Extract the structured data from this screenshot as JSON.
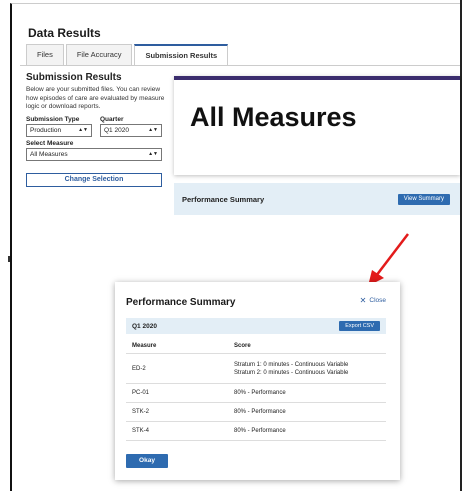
{
  "page": {
    "title": "Data Results"
  },
  "tabs": [
    {
      "label": "Files"
    },
    {
      "label": "File Accuracy"
    },
    {
      "label": "Submission Results"
    }
  ],
  "submission": {
    "title": "Submission Results",
    "description": "Below are your submitted files. You can review how episodes of care are evaluated by measure logic or download reports.",
    "type_label": "Submission Type",
    "type_value": "Production",
    "quarter_label": "Quarter",
    "quarter_value": "Q1 2020",
    "measure_label": "Select Measure",
    "measure_value": "All Measures",
    "change_button": "Change Selection"
  },
  "main": {
    "heading": "All Measures",
    "summary_label": "Performance Summary",
    "view_summary_button": "View Summary"
  },
  "modal": {
    "title": "Performance Summary",
    "close_label": "Close",
    "quarter": "Q1 2020",
    "export_button": "Export CSV",
    "columns": [
      "Measure",
      "Score"
    ],
    "rows": [
      {
        "measure": "ED-2",
        "score_lines": [
          "Stratum 1: 0 minutes - Continuous Variable",
          "Stratum 2: 0 minutes - Continuous Variable"
        ]
      },
      {
        "measure": "PC-01",
        "score_lines": [
          "80% - Performance"
        ]
      },
      {
        "measure": "STK-2",
        "score_lines": [
          "80% - Performance"
        ]
      },
      {
        "measure": "STK-4",
        "score_lines": [
          "80% - Performance"
        ]
      }
    ],
    "okay_button": "Okay"
  },
  "colors": {
    "accent": "#2e6bb0",
    "annotation_arrow": "#e31b1b",
    "banner": "#3b2d6e"
  }
}
